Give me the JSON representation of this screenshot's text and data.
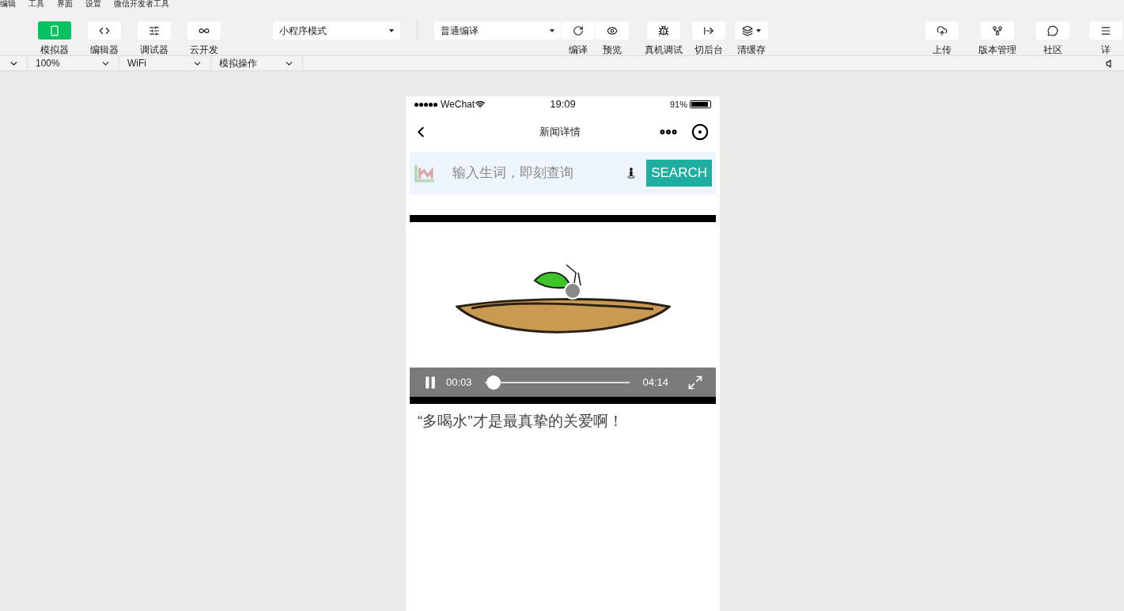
{
  "menu_bar": [
    "编辑",
    "工具",
    "界面",
    "设置",
    "微信开发者工具"
  ],
  "toolbar": {
    "views": [
      {
        "label": "模拟器",
        "selected": true
      },
      {
        "label": "编辑器",
        "selected": false
      },
      {
        "label": "调试器",
        "selected": false
      },
      {
        "label": "云开发",
        "selected": false
      }
    ],
    "mode_select": {
      "value": "小程序模式"
    },
    "compile_select": {
      "value": "普通编译"
    },
    "compile_actions": [
      {
        "label": "编译"
      },
      {
        "label": "预览"
      }
    ],
    "actions": [
      {
        "label": "真机调试"
      },
      {
        "label": "切后台"
      },
      {
        "label": "清缓存"
      }
    ],
    "right_actions": [
      {
        "label": "上传"
      },
      {
        "label": "版本管理"
      },
      {
        "label": "社区"
      },
      {
        "label": "详"
      }
    ]
  },
  "sim_bar": {
    "selects": [
      {
        "value": "100%"
      },
      {
        "value": "WiFi"
      },
      {
        "value": "模拟操作"
      }
    ]
  },
  "phone": {
    "status_bar": {
      "carrier": "WeChat",
      "time": "19:09",
      "battery": "91%"
    },
    "nav_title": "新闻详情",
    "search": {
      "placeholder": "输入生词，即刻查询",
      "button": "SEARCH"
    },
    "video": {
      "playing": true,
      "current_time": "00:03",
      "duration": "04:14",
      "level": 0.012
    },
    "headline": "“多喝水”才是最真挚的关爱啊！"
  }
}
